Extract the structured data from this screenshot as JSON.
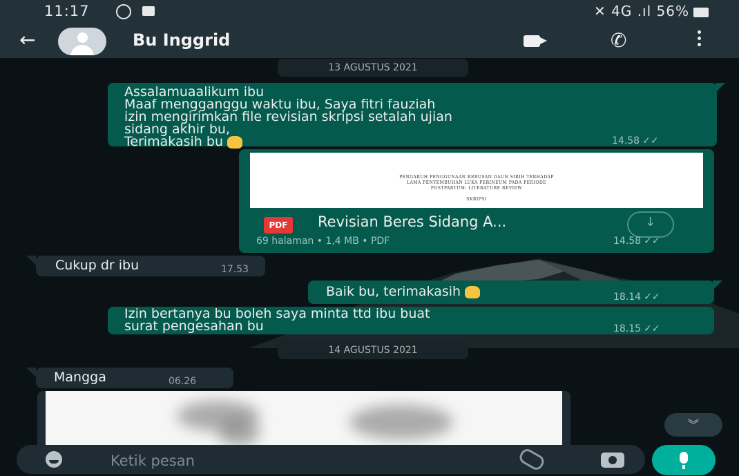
{
  "status_bar": {
    "time": "11:17",
    "network": "4G",
    "battery": "56%"
  },
  "header": {
    "contact_name": "Bu Inggrid"
  },
  "chat": {
    "date1": "13 AGUSTUS 2021",
    "msg1": {
      "lines": [
        "Assalamuaalikum ibu",
        "Maaf mengganggu waktu ibu, Saya fitri fauziah",
        "izin mengirimkan file revisian skripsi setalah ujian",
        "sidang akhir bu,",
        "Terimakasih bu"
      ],
      "time": "14.58"
    },
    "doc": {
      "preview_lines": [
        "PENGARUH PENGGUNAAN REBUSAN DAUN SIRIH TERHADAP",
        "LAMA PENYEMBUHAN LUKA PERINEUM PADA PERIODE",
        "POSTPARTUM: LITERATURE REVIEW",
        "SKRIPSI"
      ],
      "badge": "PDF",
      "name": "Revisian Beres Sidang A...",
      "info": "69 halaman • 1,4 MB • PDF",
      "time": "14.58"
    },
    "msg2": {
      "text": "Cukup dr ibu",
      "time": "17.53"
    },
    "msg3": {
      "text": "Baik bu, terimakasih",
      "time": "18.14"
    },
    "msg4": {
      "lines": [
        "Izin bertanya bu boleh saya minta ttd ibu buat",
        "surat pengesahan bu"
      ],
      "time": "18.15"
    },
    "date2": "14 AGUSTUS 2021",
    "msg5": {
      "text": "Mangga",
      "time": "06.26"
    },
    "scroll_glyph": "︾"
  },
  "input": {
    "placeholder": "Ketik pesan"
  },
  "colors": {
    "header": "#233138",
    "outgoing_bubble": "#055a4e",
    "incoming_bubble": "#1f2c33",
    "mic_button": "#00af9c"
  },
  "icons": [
    "back-arrow-icon",
    "avatar-icon",
    "video-call-icon",
    "phone-icon",
    "more-options-icon",
    "pdf-icon",
    "download-icon",
    "emoji-icon",
    "attach-icon",
    "camera-icon",
    "mic-icon",
    "scroll-down-icon"
  ]
}
